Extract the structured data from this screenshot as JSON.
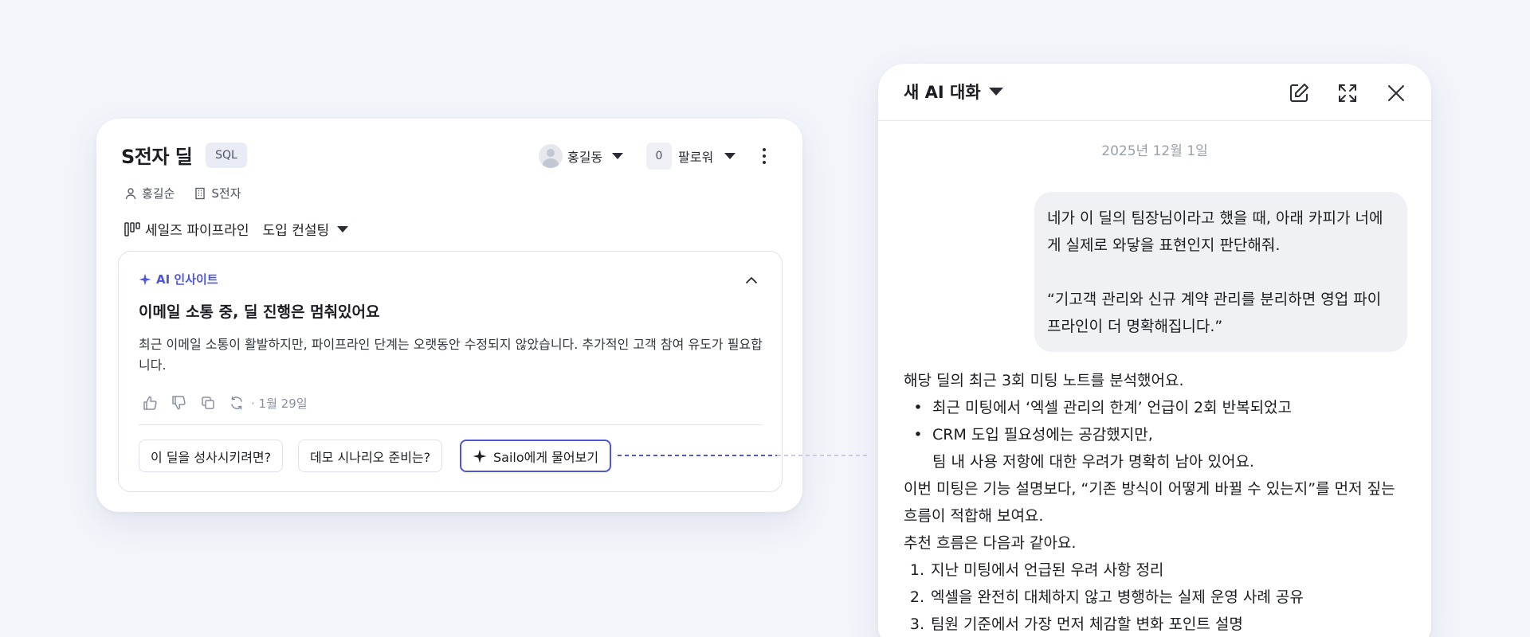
{
  "deal": {
    "title": "S전자 딜",
    "badge": "SQL",
    "owner": "홍길동",
    "follow_count": "0",
    "follow_label": "팔로워",
    "contact": "홍길순",
    "company": "S전자",
    "pipeline_label": "세일즈 파이프라인",
    "stage": "도입 컨설팅"
  },
  "insight": {
    "label": "AI 인사이트",
    "title": "이메일 소통 중, 딜 진행은 멈춰있어요",
    "body": "최근 이메일 소통이 활발하지만, 파이프라인 단계는 오랫동안 수정되지 않았습니다. 추가적인 고객 참여 유도가 필요합니다.",
    "date": "· 1월 29일",
    "chips": [
      "이 딜을 성사시키려면?",
      "데모 시나리오 준비는?"
    ],
    "ask_button": "Sailo에게 물어보기"
  },
  "chat": {
    "title": "새 AI 대화",
    "date": "2025년 12월 1일",
    "user_message": "네가 이 딜의 팀장님이라고 했을 때, 아래 카피가 너에게 실제로 와닿을 표현인지 판단해줘.\n\n“기고객 관리와 신규 계약 관리를 분리하면 영업 파이프라인이 더 명확해집니다.”",
    "reply_intro": "해당 딜의 최근 3회 미팅 노트를 분석했어요.",
    "reply_bullets": [
      "최근 미팅에서 ‘엑셀 관리의 한계’ 언급이 2회 반복되었고",
      "CRM 도입 필요성에는 공감했지만,"
    ],
    "reply_bullet_cont": "팀 내 사용 저항에 대한 우려가 명확히 남아 있어요.",
    "reply_para1": "이번 미팅은 기능 설명보다, “기존 방식이 어떻게 바뀔 수 있는지”를 먼저 짚는 흐름이 적합해 보여요.",
    "reply_para2": "추천 흐름은 다음과 같아요.",
    "reply_steps": [
      "지난 미팅에서 언급된 우려 사항 정리",
      "엑셀을 완전히 대체하지 않고 병행하는 실제 운영 사례 공유",
      "팀원 기준에서 가장 먼저 체감할 변화 포인트 설명"
    ]
  },
  "colors": {
    "accent": "#4f56d8",
    "background": "#f3f5fb"
  }
}
